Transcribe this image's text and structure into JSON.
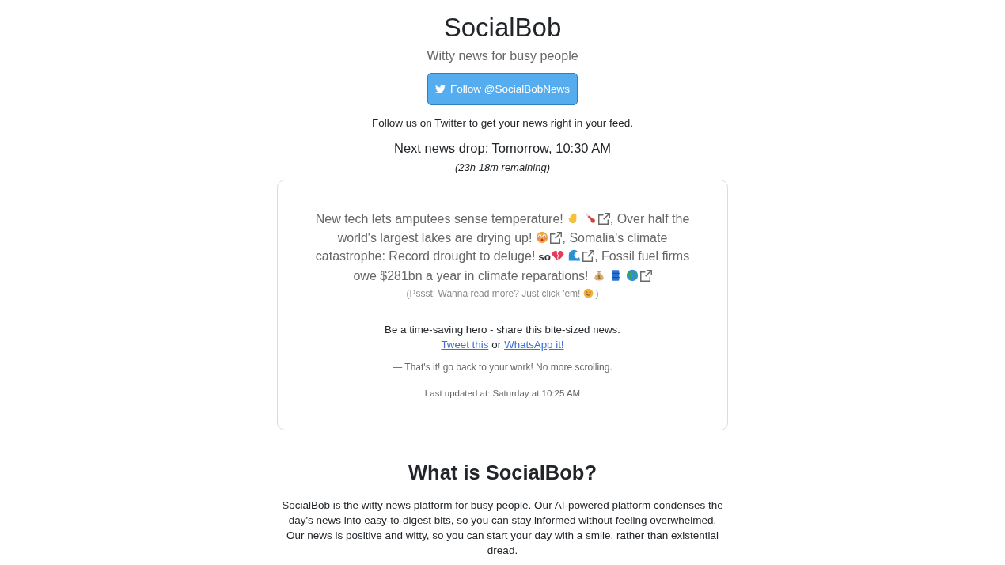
{
  "header": {
    "title": "SocialBob",
    "tagline": "Witty news for busy people"
  },
  "follow_button": {
    "label": "Follow @SocialBobNews"
  },
  "follow_note": "Follow us on Twitter to get your news right in your feed.",
  "next_drop": "Next news drop: Tomorrow, 10:30 AM",
  "remaining": "(23h 18m remaining)",
  "news_card": {
    "headlines": [
      {
        "lines": [
          "New tech lets amputees sense temperature!"
        ],
        "marks": [
          {
            "kind": "hand"
          },
          {
            "kind": "thermometer"
          }
        ],
        "separator": ","
      },
      {
        "lines": [
          "Over half the",
          "world's largest lakes are drying up!"
        ],
        "marks": [
          {
            "kind": "flushed-face"
          }
        ],
        "separator": ","
      },
      {
        "lines": [
          "Somalia's climate",
          "catastrophe: Record drought to deluge!"
        ],
        "marks": [
          {
            "kind": "text",
            "text": "so"
          },
          {
            "kind": "broken-heart"
          },
          {
            "kind": "wave"
          }
        ],
        "separator": ","
      },
      {
        "lines": [
          "Fossil fuel firms",
          "owe $281bn a year in climate reparations!"
        ],
        "marks": [
          {
            "kind": "money-bag"
          },
          {
            "kind": "oil-drum"
          },
          {
            "kind": "globe"
          }
        ]
      }
    ],
    "hint": [
      {
        "kind": "text",
        "text": "(Pssst! Wanna read more? Just click 'em!"
      },
      {
        "kind": "smiling-face"
      },
      {
        "kind": "text",
        "text": ")"
      }
    ],
    "share": {
      "prompt": "Be a time-saving hero - share this bite-sized news.",
      "links": [
        {
          "label": "Tweet this"
        },
        {
          "label": "WhatsApp it!"
        }
      ],
      "joiner": "or"
    },
    "outro": "— That's it! go back to your work! No more scrolling.",
    "last_updated": "Last updated at: Saturday at 10:25 AM"
  },
  "about": {
    "heading": "What is SocialBob?",
    "body": "SocialBob is the witty news platform for busy people. Our AI-powered platform condenses the day's news into easy-to-digest bits, so you can stay informed without feeling overwhelmed. Our news is positive and witty, so you can start your day with a smile, rather than existential dread."
  }
}
